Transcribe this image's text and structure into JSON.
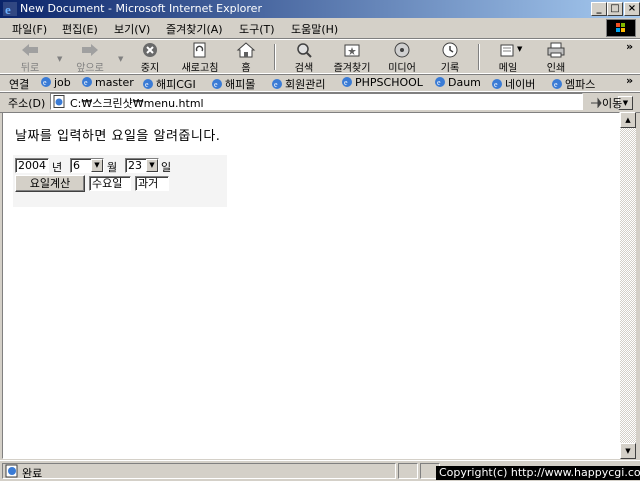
{
  "window": {
    "title": "New Document - Microsoft Internet Explorer",
    "minimize": "_",
    "maximize": "□",
    "close": "×"
  },
  "menu": [
    "파일(F)",
    "편집(E)",
    "보기(V)",
    "즐겨찾기(A)",
    "도구(T)",
    "도움말(H)"
  ],
  "toolbar": {
    "back": "뒤로",
    "forward": "앞으로",
    "stop": "중지",
    "refresh": "새로고침",
    "home": "홈",
    "search": "검색",
    "favorites": "즐겨찾기",
    "media": "미디어",
    "history": "기록",
    "mail": "메일",
    "print": "인쇄",
    "chevron": "»"
  },
  "links": {
    "label": "연결",
    "items": [
      "job",
      "master",
      "해피CGI",
      "해피몰",
      "회원관리",
      "PHPSCHOOL",
      "Daum",
      "네이버",
      "엠파스"
    ],
    "chevron": "»"
  },
  "address": {
    "label": "주소(D)",
    "value": "C:₩스크린샷₩menu.html",
    "go": "이동"
  },
  "page": {
    "heading": "날짜를 입력하면 요일을 알려줍니다.",
    "year_value": "2004",
    "year_unit": "년",
    "month_value": "6",
    "month_unit": "월",
    "day_value": "23",
    "day_unit": "일",
    "calc_button": "요일계산",
    "weekday_value": "수요일",
    "tense_value": "과거"
  },
  "status": {
    "text": "완료",
    "copyright": "Copyright(c) http://www.happycgi.com"
  },
  "colors": {
    "titlebar_start": "#0a246a",
    "titlebar_end": "#a6caf0",
    "chrome": "#d4d0c8"
  }
}
